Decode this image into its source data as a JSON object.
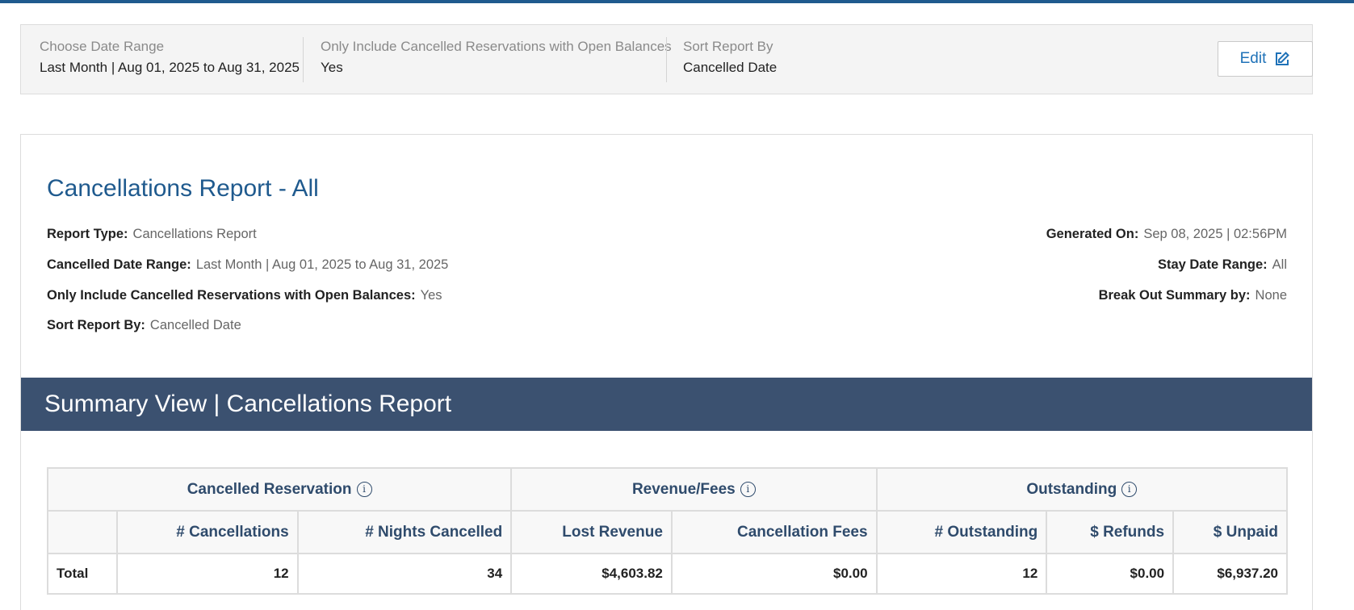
{
  "filters": [
    {
      "label": "Choose Date Range",
      "value": "Last Month | Aug 01, 2025 to Aug 31, 2025"
    },
    {
      "label": "Only Include Cancelled Reservations with Open Balances",
      "value": "Yes"
    },
    {
      "label": "Sort Report By",
      "value": "Cancelled Date"
    }
  ],
  "edit_button": {
    "label": "Edit",
    "icon": "edit-icon"
  },
  "report": {
    "title": "Cancellations Report - All",
    "meta_left": [
      {
        "label": "Report Type:",
        "value": "Cancellations Report"
      },
      {
        "label": "Cancelled Date Range:",
        "value": "Last Month | Aug 01, 2025 to Aug 31, 2025"
      },
      {
        "label": "Only Include Cancelled Reservations with Open Balances:",
        "value": "Yes"
      },
      {
        "label": "Sort Report By:",
        "value": "Cancelled Date"
      }
    ],
    "meta_right": [
      {
        "label": "Generated On:",
        "value": "Sep 08, 2025 | 02:56PM"
      },
      {
        "label": "Stay Date Range:",
        "value": "All"
      },
      {
        "label": "Break Out Summary by:",
        "value": "None"
      }
    ]
  },
  "summary": {
    "heading": "Summary View | Cancellations Report",
    "groups": [
      {
        "label": "Cancelled Reservation",
        "icon": "info-icon"
      },
      {
        "label": "Revenue/Fees",
        "icon": "info-icon"
      },
      {
        "label": "Outstanding",
        "icon": "info-icon"
      }
    ],
    "columns": [
      "",
      "# Cancellations",
      "# Nights Cancelled",
      "Lost Revenue",
      "Cancellation Fees",
      "# Outstanding",
      "$ Refunds",
      "$ Unpaid"
    ],
    "rows": [
      [
        "Total",
        "12",
        "34",
        "$4,603.82",
        "$0.00",
        "12",
        "$0.00",
        "$6,937.20"
      ]
    ]
  },
  "colors": {
    "accent": "#1f5a8e",
    "band": "#3b5170",
    "table_header_text": "#2f4b6c",
    "link": "#1f72b8"
  }
}
